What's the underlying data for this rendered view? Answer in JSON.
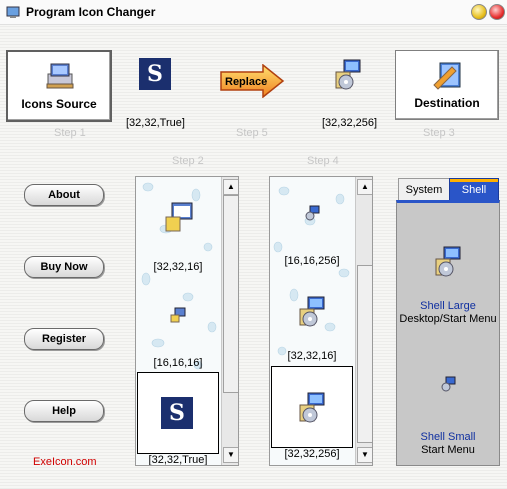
{
  "window": {
    "title": "Program Icon Changer"
  },
  "buttons": {
    "source": "Icons Source",
    "destination": "Destination",
    "replace": "Replace"
  },
  "steps": {
    "step1": "Step 1",
    "step2": "Step 2",
    "step3": "Step 3",
    "step4": "Step 4",
    "step5": "Step 5"
  },
  "source_icon_info": "[32,32,True]",
  "dest_icon_info": "[32,32,256]",
  "side_buttons": {
    "about": "About",
    "buy": "Buy Now",
    "register": "Register",
    "help": "Help"
  },
  "link": "ExeIcon.com",
  "source_list": [
    {
      "label": "[32,32,16]",
      "icon": "setup-box-icon"
    },
    {
      "label": "[16,16,16]",
      "icon": "setup-box-icon"
    },
    {
      "label": "[32,32,True]",
      "icon": "s-logo-icon",
      "selected": true
    }
  ],
  "dest_list": [
    {
      "label": "[16,16,256]",
      "icon": "installer-icon"
    },
    {
      "label": "[32,32,16]",
      "icon": "installer-icon"
    },
    {
      "label": "[32,32,256]",
      "icon": "installer-icon",
      "selected": true
    }
  ],
  "tabs": {
    "system": "System",
    "shell": "Shell",
    "active": "Shell"
  },
  "shell": {
    "large_title": "Shell Large",
    "large_sub": "Desktop/Start Menu",
    "small_title": "Shell Small",
    "small_sub": "Start Menu"
  },
  "colors": {
    "accent": "#2a55c8",
    "link": "#d00000",
    "shell_text": "#1030a0"
  }
}
